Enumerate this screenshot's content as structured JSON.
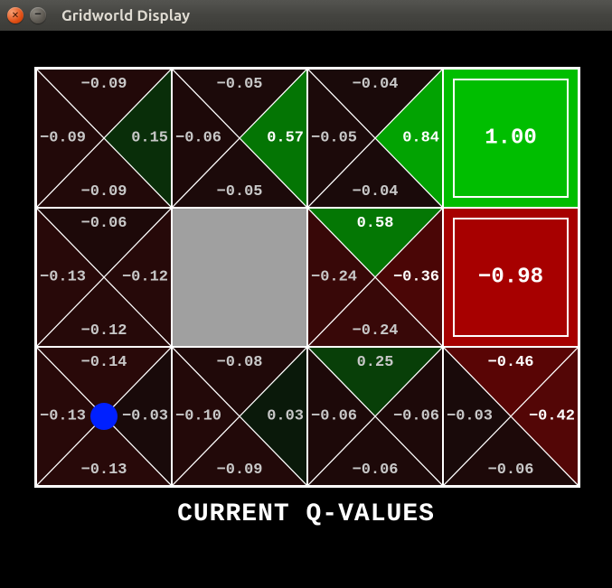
{
  "window": {
    "title": "Gridworld Display"
  },
  "footer": "CURRENT Q-VALUES",
  "rows": 3,
  "cols": 4,
  "agent": {
    "row": 2,
    "col": 0
  },
  "cells": [
    [
      {
        "type": "q",
        "n": -0.09,
        "s": -0.09,
        "e": 0.15,
        "w": -0.09
      },
      {
        "type": "q",
        "n": -0.05,
        "s": -0.05,
        "e": 0.57,
        "w": -0.06
      },
      {
        "type": "q",
        "n": -0.04,
        "s": -0.04,
        "e": 0.84,
        "w": -0.05
      },
      {
        "type": "terminal",
        "value": 1.0
      }
    ],
    [
      {
        "type": "q",
        "n": -0.06,
        "s": -0.12,
        "e": -0.12,
        "w": -0.13
      },
      {
        "type": "wall"
      },
      {
        "type": "q",
        "n": 0.58,
        "s": -0.24,
        "e": -0.36,
        "w": -0.24
      },
      {
        "type": "terminal",
        "value": -0.98
      }
    ],
    [
      {
        "type": "q",
        "n": -0.14,
        "s": -0.13,
        "e": -0.03,
        "w": -0.13
      },
      {
        "type": "q",
        "n": -0.08,
        "s": -0.09,
        "e": 0.03,
        "w": -0.1
      },
      {
        "type": "q",
        "n": 0.25,
        "s": -0.06,
        "e": -0.06,
        "w": -0.06
      },
      {
        "type": "q",
        "n": -0.46,
        "s": -0.06,
        "e": -0.42,
        "w": -0.03
      }
    ]
  ]
}
